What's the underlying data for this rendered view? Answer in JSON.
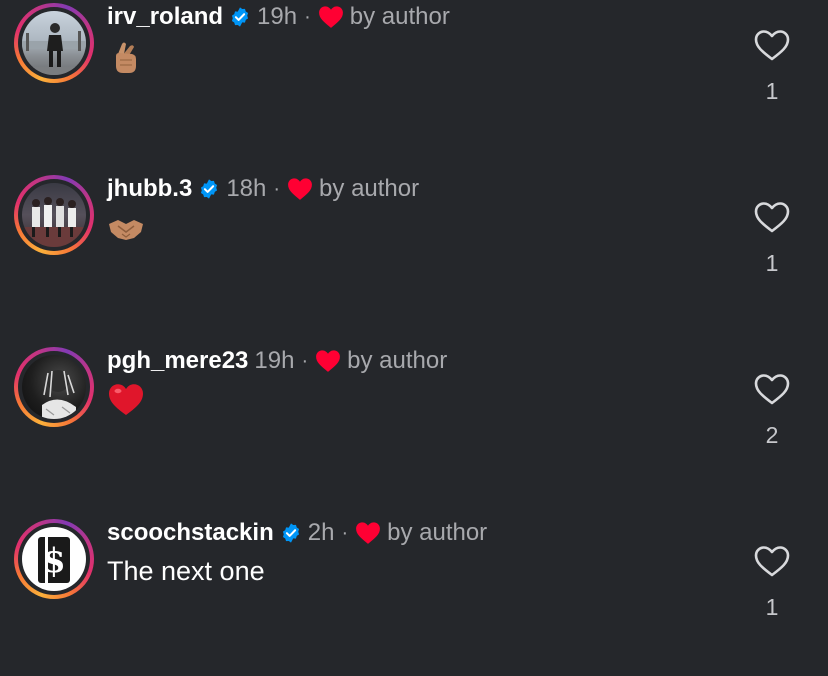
{
  "colors": {
    "background": "#25272b",
    "verified_badge": "#0095f6",
    "heart_red": "#ff0033",
    "muted_text": "#a8a9ad"
  },
  "comments": [
    {
      "username": "irv_roland",
      "verified": true,
      "time": "19h",
      "separator": "·",
      "liked_by": "by author",
      "body_emoji": "crossed-fingers-emoji",
      "body_text": "",
      "like_count": "1",
      "avatar": "person-standing-outdoors-photo"
    },
    {
      "username": "jhubb.3",
      "verified": true,
      "time": "18h",
      "separator": "·",
      "liked_by": "by author",
      "body_emoji": "handshake-emoji",
      "body_text": "",
      "like_count": "1",
      "avatar": "basketball-team-photo"
    },
    {
      "username": "pgh_mere23",
      "verified": false,
      "time": "19h",
      "separator": "·",
      "liked_by": "by author",
      "body_emoji": "red-heart-emoji",
      "body_text": "",
      "like_count": "2",
      "avatar": "dark-portrait-photo"
    },
    {
      "username": "scoochstackin",
      "verified": true,
      "time": "2h",
      "separator": "·",
      "liked_by": "by author",
      "body_emoji": "",
      "body_text": "The next one",
      "like_count": "1",
      "avatar": "dollar-sign-logo"
    }
  ]
}
